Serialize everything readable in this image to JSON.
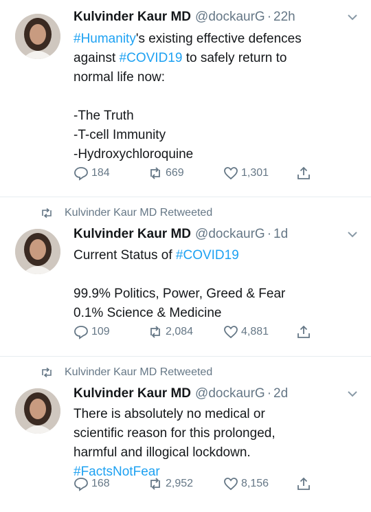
{
  "tweets": [
    {
      "retweeted_by": "",
      "author_name": "Kulvinder Kaur MD",
      "handle": "@dockaurG",
      "time": "22h",
      "lines": [
        [
          {
            "t": "#Humanity",
            "tag": true
          },
          {
            "t": "'s existing effective defences",
            "tag": false
          }
        ],
        [
          {
            "t": "against ",
            "tag": false
          },
          {
            "t": "#COVID19",
            "tag": true
          },
          {
            "t": " to safely return to",
            "tag": false
          }
        ],
        [
          {
            "t": "normal life now:",
            "tag": false
          }
        ],
        [],
        [
          {
            "t": "-The Truth",
            "tag": false
          }
        ],
        [
          {
            "t": "-T-cell Immunity",
            "tag": false
          }
        ],
        [
          {
            "t": "-Hydroxychloroquine",
            "tag": false
          }
        ]
      ],
      "replies": "184",
      "retweets": "669",
      "likes": "1,301"
    },
    {
      "retweeted_by": "Kulvinder Kaur MD Retweeted",
      "author_name": "Kulvinder Kaur MD",
      "handle": "@dockaurG",
      "time": "1d",
      "lines": [
        [
          {
            "t": "Current Status of ",
            "tag": false
          },
          {
            "t": "#COVID19",
            "tag": true
          }
        ],
        [],
        [
          {
            "t": "99.9% Politics, Power, Greed & Fear",
            "tag": false
          }
        ],
        [
          {
            "t": "0.1% Science & Medicine",
            "tag": false
          }
        ]
      ],
      "replies": "109",
      "retweets": "2,084",
      "likes": "4,881"
    },
    {
      "retweeted_by": "Kulvinder Kaur MD Retweeted",
      "author_name": "Kulvinder Kaur MD",
      "handle": "@dockaurG",
      "time": "2d",
      "lines": [
        [
          {
            "t": "There is absolutely no medical or",
            "tag": false
          }
        ],
        [
          {
            "t": "scientific reason for this prolonged,",
            "tag": false
          }
        ],
        [
          {
            "t": "harmful and illogical lockdown.",
            "tag": false
          }
        ],
        [
          {
            "t": "#FactsNotFear",
            "tag": true
          }
        ]
      ],
      "replies": "168",
      "retweets": "2,952",
      "likes": "8,156"
    }
  ],
  "colors": {
    "hashtag": "#1da1f2",
    "muted": "#657786",
    "text": "#14171a"
  },
  "icons": [
    "retweet-icon",
    "reply-icon",
    "like-icon",
    "share-icon",
    "chevron-down-icon",
    "avatar"
  ]
}
